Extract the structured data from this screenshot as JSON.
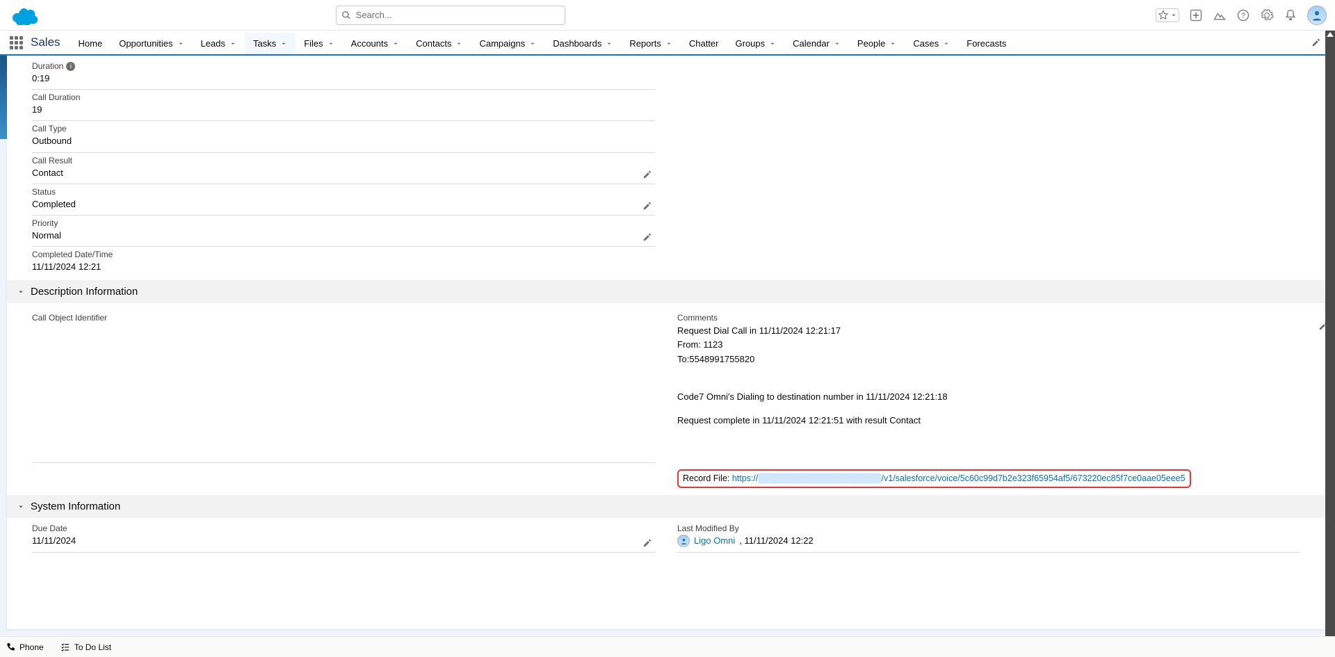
{
  "header": {
    "search_placeholder": "Search...",
    "app_name": "Sales",
    "nav": [
      {
        "label": "Home",
        "dd": false
      },
      {
        "label": "Opportunities",
        "dd": true
      },
      {
        "label": "Leads",
        "dd": true
      },
      {
        "label": "Tasks",
        "dd": true,
        "active": true
      },
      {
        "label": "Files",
        "dd": true
      },
      {
        "label": "Accounts",
        "dd": true
      },
      {
        "label": "Contacts",
        "dd": true
      },
      {
        "label": "Campaigns",
        "dd": true
      },
      {
        "label": "Dashboards",
        "dd": true
      },
      {
        "label": "Reports",
        "dd": true
      },
      {
        "label": "Chatter",
        "dd": false
      },
      {
        "label": "Groups",
        "dd": true
      },
      {
        "label": "Calendar",
        "dd": true
      },
      {
        "label": "People",
        "dd": true
      },
      {
        "label": "Cases",
        "dd": true
      },
      {
        "label": "Forecasts",
        "dd": false
      }
    ]
  },
  "fields": {
    "duration_label": "Duration",
    "duration_value": "0:19",
    "call_duration_label": "Call Duration",
    "call_duration_value": "19",
    "call_type_label": "Call Type",
    "call_type_value": "Outbound",
    "call_result_label": "Call Result",
    "call_result_value": "Contact",
    "status_label": "Status",
    "status_value": "Completed",
    "priority_label": "Priority",
    "priority_value": "Normal",
    "completed_dt_label": "Completed Date/Time",
    "completed_dt_value": "11/11/2024 12:21"
  },
  "sections": {
    "description": "Description Information",
    "system": "System Information"
  },
  "description": {
    "call_obj_id_label": "Call Object Identifier",
    "comments_label": "Comments",
    "comments_line1": "Request Dial Call in 11/11/2024 12:21:17",
    "comments_line2": "From: 1123",
    "comments_line3": "To:5548991755820",
    "comments_line4": "Code7 Omni's Dialing to destination number in 11/11/2024 12:21:18",
    "comments_line5": "Request complete in 11/11/2024 12:21:51 with result Contact",
    "record_file_label": "Record File: ",
    "record_file_url_prefix": "https://",
    "record_file_url_suffix": "/v1/salesforce/voice/5c60c99d7b2e323f65954af5/673220ec85f7ce0aae05eee5"
  },
  "system": {
    "due_date_label": "Due Date",
    "due_date_value": "11/11/2024",
    "lmb_label": "Last Modified By",
    "lmb_user": "Ligo Omni",
    "lmb_suffix": ", 11/11/2024 12:22"
  },
  "utility": {
    "phone": "Phone",
    "todo": "To Do List"
  }
}
